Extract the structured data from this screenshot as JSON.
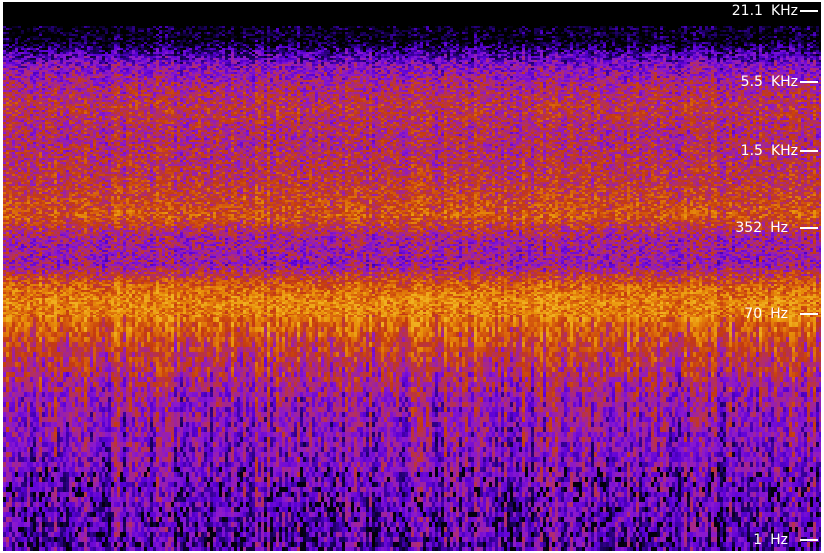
{
  "chart_data": {
    "type": "heatmap",
    "title": "",
    "xlabel": "",
    "ylabel": "",
    "yscale": "log",
    "colormap": [
      "#000000",
      "#1a0060",
      "#5a00d8",
      "#8a18d0",
      "#b02c70",
      "#c43a10",
      "#d8600c",
      "#e8900a",
      "#f0b020"
    ],
    "background": "#000000",
    "grid": false,
    "legend": "none",
    "ylim": [
      1,
      21100
    ],
    "y_ticks": [
      {
        "value": 21100,
        "num": "21.1",
        "unit": "KHz"
      },
      {
        "value": 5500,
        "num": "5.5",
        "unit": "KHz"
      },
      {
        "value": 1500,
        "num": "1.5",
        "unit": "KHz"
      },
      {
        "value": 352,
        "num": "352",
        "unit": "Hz"
      },
      {
        "value": 70,
        "num": "70",
        "unit": "Hz"
      },
      {
        "value": 1,
        "num": "1",
        "unit": "Hz"
      }
    ],
    "intensity_profile": [
      {
        "freq": 21100,
        "level": 0.0
      },
      {
        "freq": 12000,
        "level": 0.02
      },
      {
        "freq": 9500,
        "level": 0.22
      },
      {
        "freq": 7500,
        "level": 0.36
      },
      {
        "freq": 5500,
        "level": 0.46
      },
      {
        "freq": 3500,
        "level": 0.56
      },
      {
        "freq": 2000,
        "level": 0.5
      },
      {
        "freq": 1500,
        "level": 0.52
      },
      {
        "freq": 800,
        "level": 0.58
      },
      {
        "freq": 450,
        "level": 0.7
      },
      {
        "freq": 300,
        "level": 0.46
      },
      {
        "freq": 180,
        "level": 0.42
      },
      {
        "freq": 120,
        "level": 0.74
      },
      {
        "freq": 90,
        "level": 0.85
      },
      {
        "freq": 70,
        "level": 0.82
      },
      {
        "freq": 40,
        "level": 0.62
      },
      {
        "freq": 15,
        "level": 0.42
      },
      {
        "freq": 4,
        "level": 0.33
      },
      {
        "freq": 1,
        "level": 0.25
      }
    ]
  }
}
